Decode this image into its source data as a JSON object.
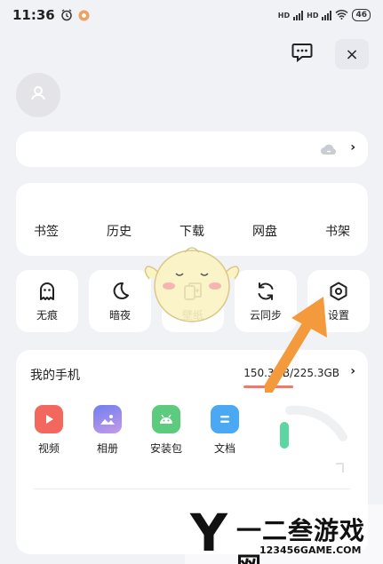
{
  "status_bar": {
    "time": "11:36",
    "network_badge_1": "HD",
    "network_badge_2": "HD",
    "battery": "46"
  },
  "header": {
    "message_icon": "message-dots-icon",
    "close_icon": "close-icon",
    "close_label": "×"
  },
  "login_card": {
    "cloud_icon": "cloud-icon",
    "chevron": "›"
  },
  "tabs": [
    {
      "label": "书签"
    },
    {
      "label": "历史"
    },
    {
      "label": "下载"
    },
    {
      "label": "网盘"
    },
    {
      "label": "书架"
    }
  ],
  "tools": [
    {
      "label": "无痕",
      "icon": "ghost-icon"
    },
    {
      "label": "暗夜",
      "icon": "moon-icon"
    },
    {
      "label": "壁纸",
      "icon": "wallpaper-icon"
    },
    {
      "label": "云同步",
      "icon": "sync-icon"
    },
    {
      "label": "设置",
      "icon": "settings-icon"
    }
  ],
  "my_phone": {
    "title": "我的手机",
    "storage": "150.3GB/225.3GB",
    "chevron": "›",
    "apps": [
      {
        "label": "视频",
        "icon": "video-icon",
        "color": "#f2675e"
      },
      {
        "label": "相册",
        "icon": "photo-icon",
        "color": "#8e8cf0"
      },
      {
        "label": "安装包",
        "icon": "android-icon",
        "color": "#5dcb7e"
      },
      {
        "label": "文档",
        "icon": "document-icon",
        "color": "#4aa9f2"
      }
    ]
  },
  "watermark": {
    "letter": "Y",
    "text": "一二叁游戏网",
    "url": "123456GAME.COM"
  }
}
